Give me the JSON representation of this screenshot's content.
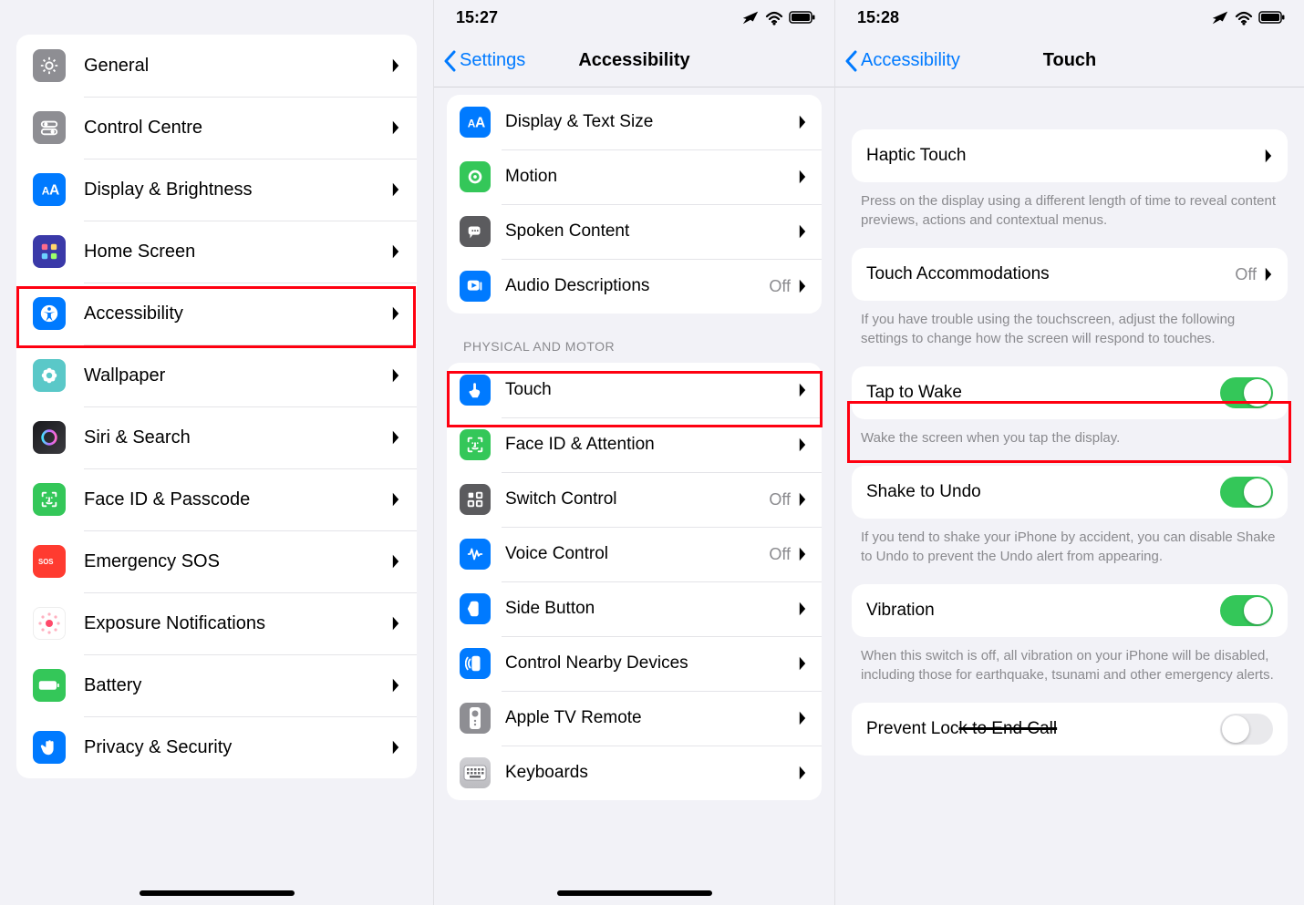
{
  "status": {
    "time_s2": "15:27",
    "time_s3": "15:28",
    "airplane_icon": "airplane-icon",
    "wifi_icon": "wifi-icon",
    "battery_icon": "battery-icon"
  },
  "screen1": {
    "rows": [
      {
        "icon": "gear-icon",
        "icon_class": "ic-grey",
        "label": "General"
      },
      {
        "icon": "switches-icon",
        "icon_class": "ic-grey",
        "label": "Control Centre"
      },
      {
        "icon": "text-size-icon",
        "icon_class": "ic-blue",
        "label": "Display & Brightness"
      },
      {
        "icon": "home-grid-icon",
        "icon_class": "ic-swatch",
        "label": "Home Screen"
      },
      {
        "icon": "accessibility-icon",
        "icon_class": "ic-blue",
        "label": "Accessibility"
      },
      {
        "icon": "flower-icon",
        "icon_class": "ic-teal",
        "label": "Wallpaper"
      },
      {
        "icon": "siri-icon",
        "icon_class": "ic-siri",
        "label": "Siri & Search"
      },
      {
        "icon": "faceid-icon",
        "icon_class": "ic-green",
        "label": "Face ID & Passcode"
      },
      {
        "icon": "sos-icon",
        "icon_class": "ic-red",
        "label": "Emergency SOS"
      },
      {
        "icon": "exposure-icon",
        "icon_class": "ic-exposure",
        "label": "Exposure Notifications"
      },
      {
        "icon": "battery-icon",
        "icon_class": "ic-green",
        "label": "Battery"
      },
      {
        "icon": "hand-icon",
        "icon_class": "ic-hand",
        "label": "Privacy & Security"
      }
    ],
    "highlight_index": 4
  },
  "screen2": {
    "back_label": "Settings",
    "title": "Accessibility",
    "group1": [
      {
        "icon": "text-size-icon",
        "icon_class": "ic-blue",
        "label": "Display & Text Size",
        "value": ""
      },
      {
        "icon": "motion-icon",
        "icon_class": "ic-green",
        "label": "Motion",
        "value": ""
      },
      {
        "icon": "spoken-icon",
        "icon_class": "ic-darkg",
        "label": "Spoken Content",
        "value": ""
      },
      {
        "icon": "ad-icon",
        "icon_class": "ic-blue",
        "label": "Audio Descriptions",
        "value": "Off"
      }
    ],
    "section_header": "PHYSICAL AND MOTOR",
    "group2": [
      {
        "icon": "touch-icon",
        "icon_class": "ic-blue",
        "label": "Touch",
        "value": ""
      },
      {
        "icon": "faceid-icon",
        "icon_class": "ic-green",
        "label": "Face ID & Attention",
        "value": ""
      },
      {
        "icon": "switch-ctrl-icon",
        "icon_class": "ic-darkg",
        "label": "Switch Control",
        "value": "Off"
      },
      {
        "icon": "voice-ctrl-icon",
        "icon_class": "ic-blue",
        "label": "Voice Control",
        "value": "Off"
      },
      {
        "icon": "side-btn-icon",
        "icon_class": "ic-blue",
        "label": "Side Button",
        "value": ""
      },
      {
        "icon": "nearby-icon",
        "icon_class": "ic-blue",
        "label": "Control Nearby Devices",
        "value": ""
      },
      {
        "icon": "appletv-icon",
        "icon_class": "ic-grey",
        "label": "Apple TV Remote",
        "value": ""
      },
      {
        "icon": "keyboard-icon",
        "icon_class": "ic-keyboard",
        "label": "Keyboards",
        "value": ""
      }
    ],
    "highlight_group2_index": 0
  },
  "screen3": {
    "back_label": "Accessibility",
    "title": "Touch",
    "haptic": {
      "label": "Haptic Touch",
      "footer": "Press on the display using a different length of time to reveal content previews, actions and contextual menus."
    },
    "accom": {
      "label": "Touch Accommodations",
      "value": "Off",
      "footer": "If you have trouble using the touchscreen, adjust the following settings to change how the screen will respond to touches."
    },
    "tap": {
      "label": "Tap to Wake",
      "on": true,
      "footer": "Wake the screen when you tap the display."
    },
    "shake": {
      "label": "Shake to Undo",
      "on": true,
      "footer": "If you tend to shake your iPhone by accident, you can disable Shake to Undo to prevent the Undo alert from appearing."
    },
    "vib": {
      "label": "Vibration",
      "on": true,
      "footer": "When this switch is off, all vibration on your iPhone will be disabled, including those for earthquake, tsunami and other emergency alerts."
    },
    "lock": {
      "label_pre": "Prevent Loc",
      "label_strike": "k to End Call",
      "on": false
    }
  }
}
